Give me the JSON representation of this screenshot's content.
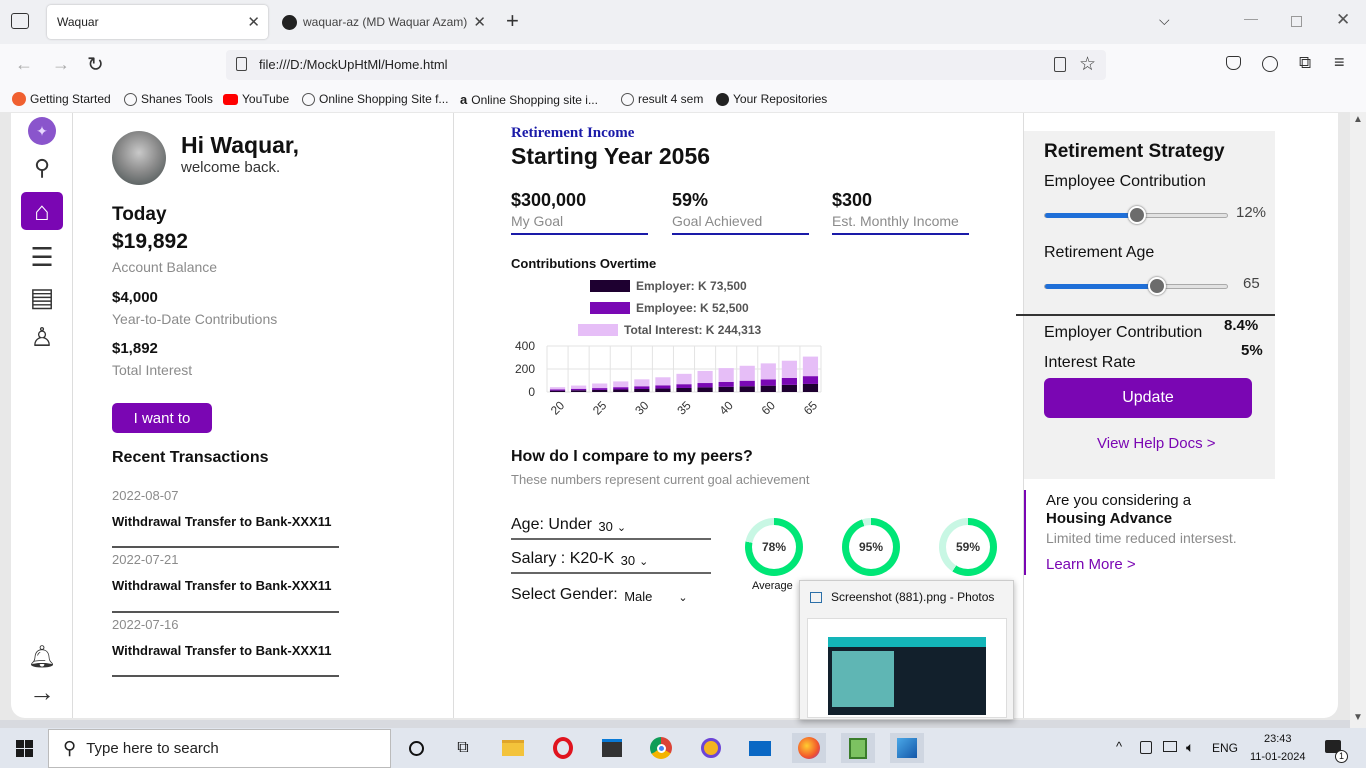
{
  "browser": {
    "tabs": [
      {
        "label": "Waquar"
      },
      {
        "label": "waquar-az (MD Waquar Azam)"
      }
    ],
    "url": "file:///D:/MockUpHtMl/Home.html",
    "bookmarks": [
      "Getting Started",
      "Shanes Tools",
      "YouTube",
      "Online Shopping Site f...",
      "Online Shopping site i...",
      "result 4 sem",
      "Your Repositories"
    ]
  },
  "user": {
    "greeting": "Hi Waquar,",
    "subgreeting": "welcome back."
  },
  "today": {
    "heading": "Today",
    "balance": "$19,892",
    "balance_label": "Account Balance",
    "ytd": "$4,000",
    "ytd_label": "Year-to-Date Contributions",
    "interest": "$1,892",
    "interest_label": "Total Interest",
    "action_button": "I want to"
  },
  "transactions": {
    "heading": "Recent Transactions",
    "items": [
      {
        "date": "2022-08-07",
        "desc": "Withdrawal Transfer to Bank-XXX11"
      },
      {
        "date": "2022-07-21",
        "desc": "Withdrawal Transfer to Bank-XXX11"
      },
      {
        "date": "2022-07-16",
        "desc": "Withdrawal Transfer to Bank-XXX11"
      }
    ]
  },
  "retirement": {
    "kicker": "Retirement Income",
    "title": "Starting Year 2056",
    "stats": [
      {
        "value": "$300,000",
        "label": "My Goal"
      },
      {
        "value": "59%",
        "label": "Goal Achieved"
      },
      {
        "value": "$300",
        "label": "Est. Monthly Income"
      }
    ]
  },
  "chart_data": {
    "type": "bar",
    "title": "Contributions Overtime",
    "categories": [
      "20",
      "",
      "25",
      "",
      "30",
      "",
      "35",
      "",
      "40",
      "",
      "60",
      "",
      "65"
    ],
    "visible_tick_labels": [
      "20",
      "25",
      "30",
      "35",
      "40",
      "60",
      "65"
    ],
    "ylim": [
      0,
      400
    ],
    "yticks": [
      "400",
      "200",
      "0"
    ],
    "stacked": true,
    "grid": true,
    "legend_position": "top",
    "series": [
      {
        "name": "Employer: K 73,500",
        "color": "#1e0030",
        "values": [
          12,
          15,
          18,
          22,
          26,
          30,
          35,
          40,
          45,
          50,
          55,
          62,
          70
        ]
      },
      {
        "name": "Employee: K 52,500",
        "color": "#7a08b4",
        "values": [
          10,
          13,
          16,
          20,
          24,
          28,
          33,
          38,
          43,
          48,
          54,
          60,
          68
        ]
      },
      {
        "name": "Total Interest: K 244,313",
        "color": "#e6bef7",
        "values": [
          20,
          28,
          40,
          50,
          60,
          70,
          90,
          105,
          120,
          130,
          140,
          150,
          170
        ]
      }
    ]
  },
  "peers": {
    "heading": "How do I compare to my peers?",
    "subheading": "These numbers represent current goal achievement",
    "filters": [
      {
        "label": "Age: Under",
        "value": "30"
      },
      {
        "label": "Salary : K20-K",
        "value": "30"
      },
      {
        "label": "Select Gender:",
        "value": "Male"
      }
    ],
    "rings": [
      {
        "value": "78%",
        "pct": 78,
        "caption": "Average"
      },
      {
        "value": "95%",
        "pct": 95,
        "caption": ""
      },
      {
        "value": "59%",
        "pct": 59,
        "caption": ""
      }
    ]
  },
  "strategy": {
    "title": "Retirement Strategy",
    "employee_label": "Employee Contribution",
    "employee_value": "12%",
    "employee_level": 0.5,
    "age_label": "Retirement Age",
    "age_value": "65",
    "age_level": 0.61,
    "employer_label": "Employer Contribution",
    "employer_value": "8.4%",
    "interest_label": "Interest Rate",
    "interest_value": "5%",
    "update_button": "Update",
    "help_link": "View Help Docs >"
  },
  "promo": {
    "line1": "Are you considering a",
    "line2": "Housing Advance",
    "line3": "Limited time reduced intersest.",
    "link": "Learn More >"
  },
  "preview": {
    "title": "Screenshot (881).png - Photos"
  },
  "taskbar": {
    "search_placeholder": "Type here to search",
    "lang": "ENG",
    "time": "23:43",
    "date": "11-01-2024",
    "notif_count": "1"
  },
  "colors": {
    "accent": "#7a06b3",
    "ring": "#00e676",
    "kicker": "#1a1aa8"
  }
}
